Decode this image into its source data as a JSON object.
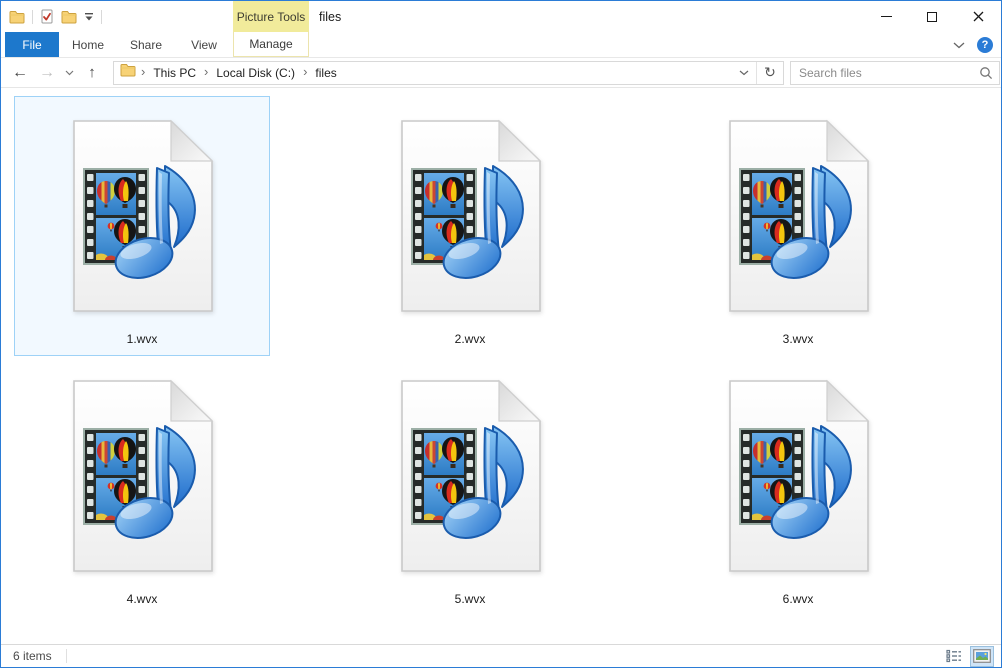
{
  "window": {
    "title": "files",
    "controls": {
      "minimize": "minimize",
      "maximize": "maximize",
      "close": "close"
    }
  },
  "quick_access_toolbar": {
    "icons": [
      "file-explorer-folder",
      "properties-check",
      "new-folder",
      "customize-dropdown"
    ]
  },
  "ribbon": {
    "contextual_group": "Picture Tools",
    "tabs": [
      {
        "label": "File",
        "active": true
      },
      {
        "label": "Home",
        "active": false
      },
      {
        "label": "Share",
        "active": false
      },
      {
        "label": "View",
        "active": false
      },
      {
        "label": "Manage",
        "active": false,
        "contextual": true
      }
    ],
    "minimize_ribbon_icon": "chevron-down",
    "help_label": "?"
  },
  "address_bar": {
    "crumbs": [
      "This PC",
      "Local Disk (C:)",
      "files"
    ],
    "separator": "›",
    "refresh_icon": "↻",
    "icons": [
      "folder-icon",
      "history-chevron",
      "refresh"
    ]
  },
  "search": {
    "placeholder": "Search files"
  },
  "files": {
    "file_type_icon": "wvx-video-playlist (filmstrip with hot-air balloons + blue music note on white page)",
    "items": [
      {
        "name": "1.wvx",
        "selected": true
      },
      {
        "name": "2.wvx",
        "selected": false
      },
      {
        "name": "3.wvx",
        "selected": false
      },
      {
        "name": "4.wvx",
        "selected": false
      },
      {
        "name": "5.wvx",
        "selected": false
      },
      {
        "name": "6.wvx",
        "selected": false
      }
    ]
  },
  "status_bar": {
    "items_count": "6 items",
    "view_toggles": [
      "details-view",
      "large-icons-view"
    ]
  },
  "colors": {
    "accent_blue": "#2b7cd6",
    "file_tab_bg": "#1d78cc",
    "contextual_yellow": "#f1eb9b",
    "selection_border": "#9ed2f7",
    "selection_bg": "#f2f9ff",
    "note_blue": "#2e86d8",
    "sky_blue": "#3f8fd6"
  }
}
